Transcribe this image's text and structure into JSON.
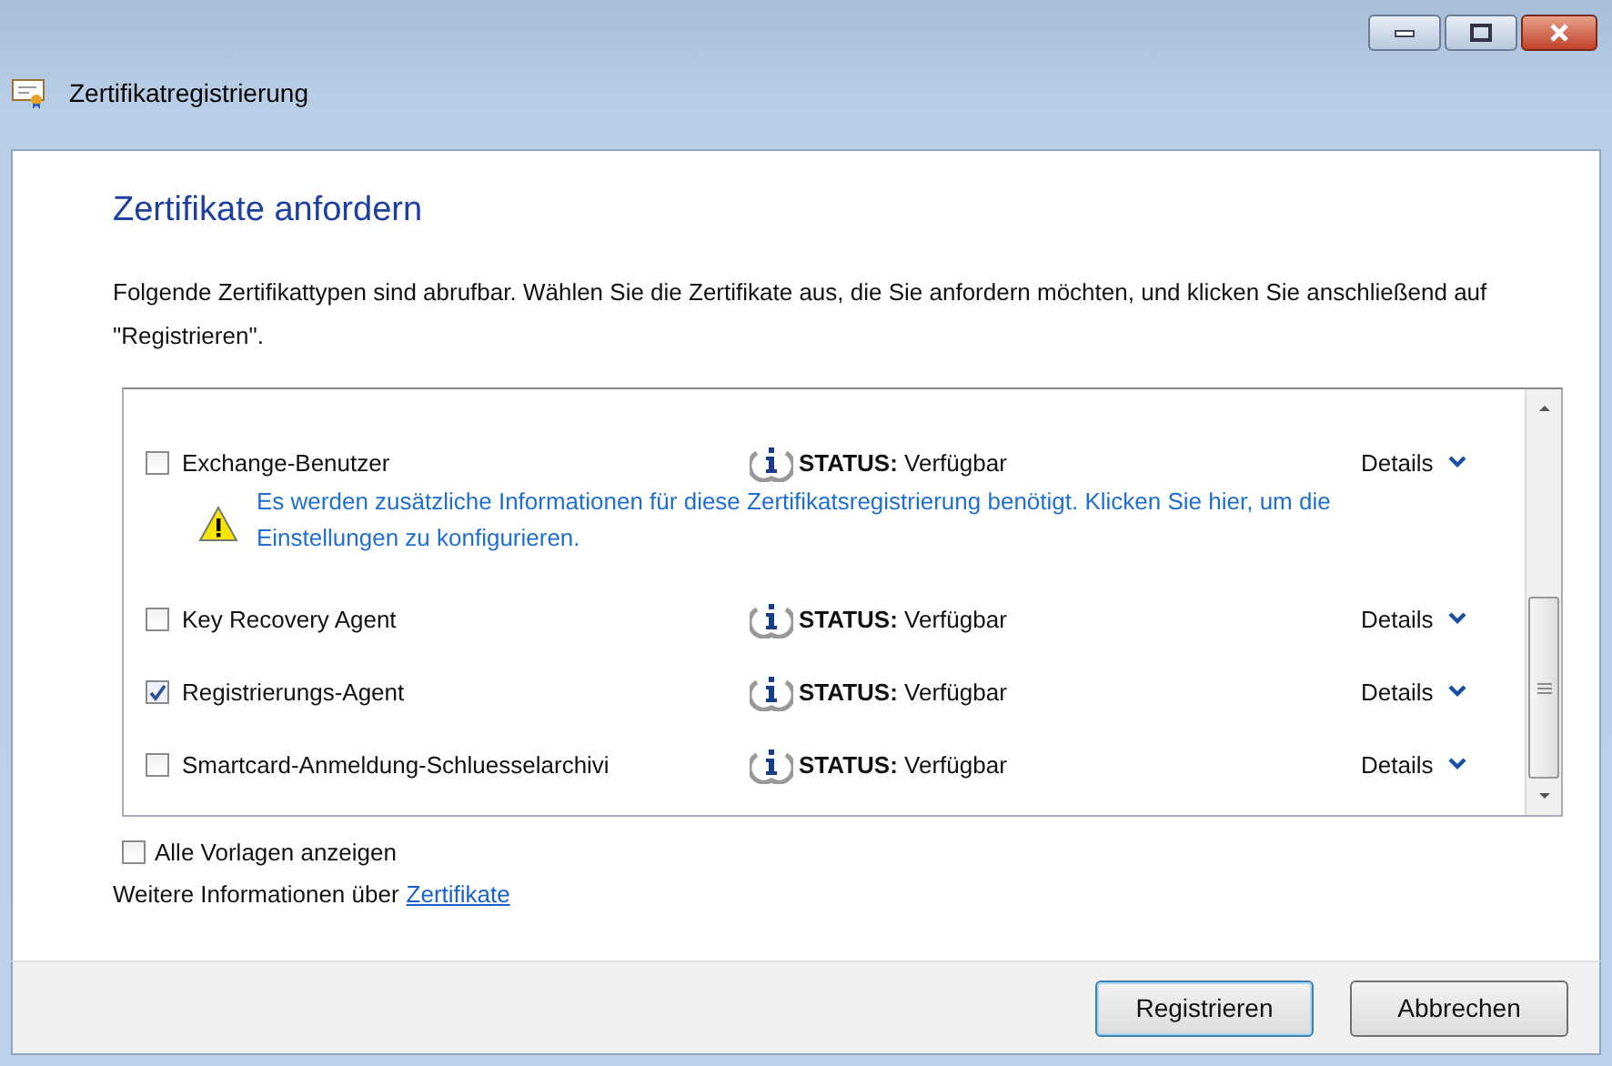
{
  "window": {
    "title": "Zertifikatregistrierung"
  },
  "heading": "Zertifikate anfordern",
  "instructions": "Folgende Zertifikattypen sind abrufbar. Wählen Sie die Zertifikate aus, die Sie anfordern möchten, und klicken Sie anschließend auf \"Registrieren\".",
  "templates": [
    {
      "name": "Exchange-Benutzer",
      "checked": false,
      "status": "**STATUS:** Verfügbar",
      "details": "Details",
      "warning": "Es werden zusätzliche Informationen für diese Zertifikatsregistrierung benötigt. Klicken Sie hier, um die Einstellungen zu konfigurieren."
    },
    {
      "name": "Key Recovery Agent",
      "checked": false,
      "status": "**STATUS:** Verfügbar",
      "details": "Details"
    },
    {
      "name": "Registrierungs-Agent",
      "checked": true,
      "status": "**STATUS:** Verfügbar",
      "details": "Details"
    },
    {
      "name": "Smartcard-Anmeldung-Schluesselarchivi",
      "checked": false,
      "status": "**STATUS:** Verfügbar",
      "details": "Details"
    }
  ],
  "show_all": {
    "label": "Alle Vorlagen anzeigen",
    "checked": false
  },
  "more_info": {
    "text": "Weitere Informationen über",
    "link": "Zertifikate"
  },
  "buttons": [
    {
      "label": "Registrieren",
      "default": true
    },
    {
      "label": "Abbrechen",
      "default": false
    }
  ]
}
